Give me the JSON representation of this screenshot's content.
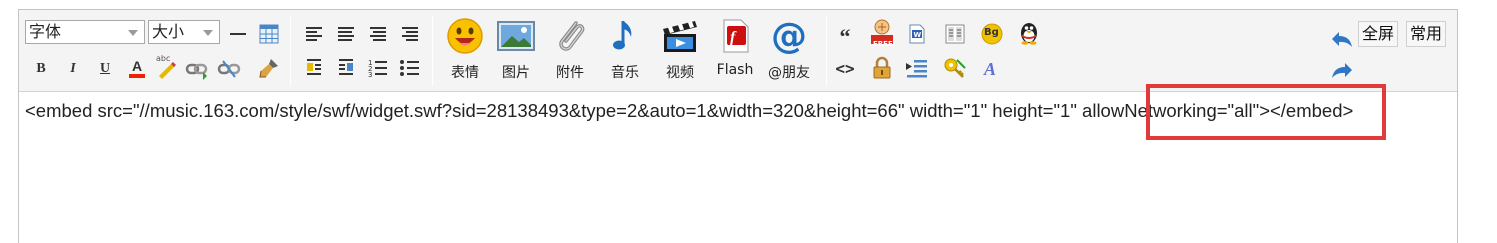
{
  "toolbar": {
    "font_family": {
      "value": "字体"
    },
    "font_size": {
      "value": "大小"
    },
    "big_buttons": [
      {
        "label": "表情",
        "icon": "emoji-icon"
      },
      {
        "label": "图片",
        "icon": "image-icon"
      },
      {
        "label": "附件",
        "icon": "attachment-icon"
      },
      {
        "label": "音乐",
        "icon": "music-icon"
      },
      {
        "label": "视频",
        "icon": "video-icon"
      },
      {
        "label": "Flash",
        "icon": "flash-icon"
      },
      {
        "label": "@朋友",
        "icon": "at-friend-icon"
      }
    ],
    "right": {
      "fullscreen": "全屏",
      "common": "常用"
    },
    "icon_glyphs": {
      "bold": "B",
      "italic": "I",
      "underline": "U",
      "quote": "“",
      "code": "<>",
      "free": "FREE",
      "bg": "Bg",
      "font_color": "A",
      "abc": "abc"
    }
  },
  "editor": {
    "content": "<embed src=\"//music.163.com/style/swf/widget.swf?sid=28138493&type=2&auto=1&width=320&height=66\" width=\"1\" height=\"1\" allowNetworking=\"all\"></embed>"
  },
  "colors": {
    "highlight": "#e03a3a",
    "accent_blue": "#2a7fd0",
    "toolbar_bg": "#f4f4f4"
  }
}
